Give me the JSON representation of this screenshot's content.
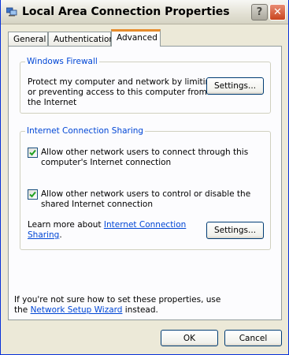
{
  "window": {
    "title": "Local Area Connection Properties"
  },
  "title_buttons": {
    "help_label": "?",
    "close_label": "✕"
  },
  "tabs": [
    {
      "label": "General"
    },
    {
      "label": "Authentication"
    },
    {
      "label": "Advanced"
    }
  ],
  "firewall": {
    "group_title": "Windows Firewall",
    "description_lines": [
      "Protect my computer and network by limiting",
      "or preventing access to this computer from",
      "the Internet"
    ],
    "settings_label": "Settings..."
  },
  "ics": {
    "group_title": "Internet Connection Sharing",
    "option1_lines": [
      "Allow other network users to connect through this",
      "computer's Internet connection"
    ],
    "option2_lines": [
      "Allow other network users to control or disable the",
      "shared Internet connection"
    ],
    "option1_checked": true,
    "option2_checked": true,
    "learn_prefix": "Learn more about ",
    "learn_link_1": "Internet Connection",
    "learn_link_2": "Sharing",
    "learn_suffix": ".",
    "settings_label": "Settings..."
  },
  "footer": {
    "line1": "If you're not sure how to set these properties, use",
    "line2_prefix": "the ",
    "wizard_link": "Network Setup Wizard",
    "line2_suffix": " instead."
  },
  "buttons": {
    "ok_label": "OK",
    "cancel_label": "Cancel"
  }
}
